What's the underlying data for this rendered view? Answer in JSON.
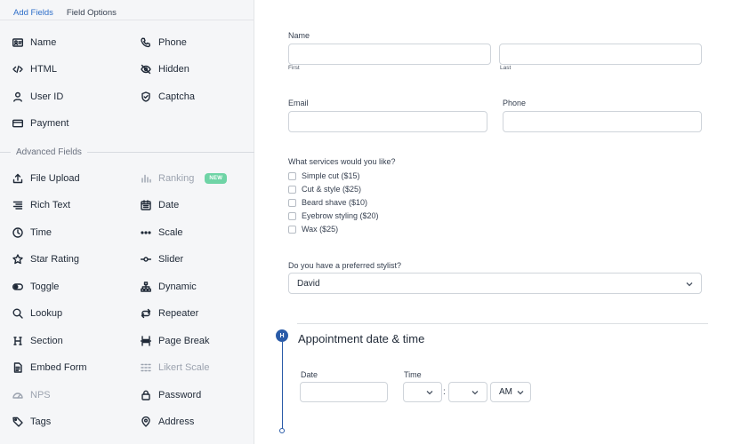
{
  "tabs": {
    "add_fields": "Add Fields",
    "field_options": "Field Options"
  },
  "sidebar": {
    "basic_left": [
      "Name",
      "HTML",
      "User ID",
      "Payment"
    ],
    "basic_right": [
      "Phone",
      "Hidden",
      "Captcha"
    ],
    "advanced_heading": "Advanced Fields",
    "adv_left": [
      "File Upload",
      "Rich Text",
      "Time",
      "Star Rating",
      "Toggle",
      "Lookup",
      "Section",
      "Embed Form",
      "NPS",
      "Tags"
    ],
    "adv_right": [
      "Ranking",
      "Date",
      "Scale",
      "Slider",
      "Dynamic",
      "Repeater",
      "Page Break",
      "Likert Scale",
      "Password",
      "Address"
    ],
    "new_badge": "NEW"
  },
  "form": {
    "name_label": "Name",
    "first_sub": "First",
    "last_sub": "Last",
    "email_label": "Email",
    "phone_label": "Phone",
    "services_label": "What services would you like?",
    "services": [
      "Simple cut ($15)",
      "Cut & style ($25)",
      "Beard shave ($10)",
      "Eyebrow styling ($20)",
      "Wax ($25)"
    ],
    "stylist_label": "Do you have a preferred stylist?",
    "stylist_value": "David",
    "section_title": "Appointment date & time",
    "section_marker": "H",
    "date_label": "Date",
    "time_label": "Time",
    "time_colon": ":",
    "ampm_value": "AM"
  },
  "colors": {
    "accent": "#2f6fc9",
    "section_marker": "#2a5ba8",
    "new_badge": "#6fd4a6"
  }
}
